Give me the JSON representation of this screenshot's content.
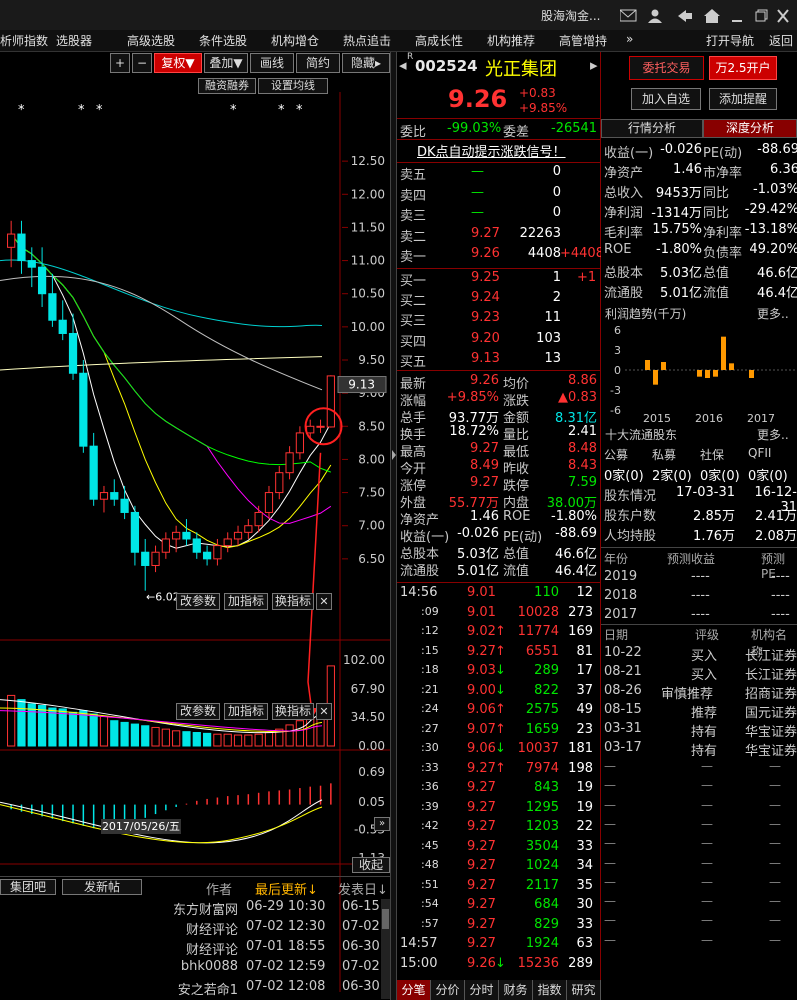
{
  "title": "股海淘金...",
  "menu": [
    "析师指数",
    "选股器",
    "高级选股",
    "条件选股",
    "机构增仓",
    "热点追击",
    "高成长性",
    "机构推荐",
    "高管增持",
    "»",
    "打开导航",
    "返回"
  ],
  "toolbar": {
    "plus": "+",
    "minus": "−",
    "fuquan": "复权▼",
    "diejia": "叠加▼",
    "huaxian": "画线",
    "jianyue": "简约",
    "yincang": "隐藏▸",
    "rongzi": "融资融券",
    "shezhi": "设置均线"
  },
  "stock": {
    "code": "002524",
    "name": "光正集团",
    "price": "9.26",
    "change": "+0.83",
    "change_pct": "+9.85%"
  },
  "buttons": {
    "weituo": "委托交易",
    "wan": "万2.5开户",
    "jiaru": "加入自选",
    "tixing": "添加提醒"
  },
  "weibi": {
    "label1": "委比",
    "value1": "-99.03%",
    "label2": "委差",
    "value2": "-26541"
  },
  "signal": "DK点自动提示涨跌信号！",
  "sell": [
    {
      "label": "卖五",
      "price": "—",
      "vol": "0",
      "chg": ""
    },
    {
      "label": "卖四",
      "price": "—",
      "vol": "0",
      "chg": ""
    },
    {
      "label": "卖三",
      "price": "—",
      "vol": "0",
      "chg": ""
    },
    {
      "label": "卖二",
      "price": "9.27",
      "vol": "22263",
      "chg": ""
    },
    {
      "label": "卖一",
      "price": "9.26",
      "vol": "4408",
      "chg": "+4408"
    }
  ],
  "buy": [
    {
      "label": "买一",
      "price": "9.25",
      "vol": "1",
      "chg": "+1"
    },
    {
      "label": "买二",
      "price": "9.24",
      "vol": "2",
      "chg": ""
    },
    {
      "label": "买三",
      "price": "9.23",
      "vol": "11",
      "chg": ""
    },
    {
      "label": "买四",
      "price": "9.20",
      "vol": "103",
      "chg": ""
    },
    {
      "label": "买五",
      "price": "9.13",
      "vol": "13",
      "chg": ""
    }
  ],
  "stats": [
    [
      "最新",
      "9.26",
      "均价",
      "8.86"
    ],
    [
      "涨幅",
      "+9.85%",
      "涨跌",
      "▲0.83"
    ],
    [
      "总手",
      "93.77万",
      "金额",
      "8.31亿"
    ],
    [
      "换手",
      "18.72%",
      "量比",
      "2.41"
    ],
    [
      "最高",
      "9.27",
      "最低",
      "8.48"
    ],
    [
      "今开",
      "8.49",
      "昨收",
      "8.43"
    ],
    [
      "涨停",
      "9.27",
      "跌停",
      "7.59"
    ],
    [
      "外盘",
      "55.77万",
      "内盘",
      "38.00万"
    ],
    [
      "净资产",
      "1.46",
      "ROE",
      "-1.80%"
    ],
    [
      "收益(一)",
      "-0.026",
      "PE(动)",
      "-88.69"
    ],
    [
      "总股本",
      "5.03亿",
      "总值",
      "46.6亿"
    ],
    [
      "流通股",
      "5.01亿",
      "流值",
      "46.4亿"
    ]
  ],
  "ticks": [
    {
      "t": "14:56",
      "p": "9.01",
      "a": "",
      "v": "110",
      "n": "12"
    },
    {
      "t": ":09",
      "p": "9.01",
      "a": "",
      "v": "10028",
      "n": "273"
    },
    {
      "t": ":12",
      "p": "9.02",
      "a": "↑",
      "v": "11774",
      "n": "169"
    },
    {
      "t": ":15",
      "p": "9.27",
      "a": "↑",
      "v": "6551",
      "n": "81"
    },
    {
      "t": ":18",
      "p": "9.03",
      "a": "↓",
      "v": "289",
      "n": "17"
    },
    {
      "t": ":21",
      "p": "9.00",
      "a": "↓",
      "v": "822",
      "n": "37"
    },
    {
      "t": ":24",
      "p": "9.06",
      "a": "↑",
      "v": "2575",
      "n": "49"
    },
    {
      "t": ":27",
      "p": "9.07",
      "a": "↑",
      "v": "1659",
      "n": "23"
    },
    {
      "t": ":30",
      "p": "9.06",
      "a": "↓",
      "v": "10037",
      "n": "181"
    },
    {
      "t": ":33",
      "p": "9.27",
      "a": "↑",
      "v": "7974",
      "n": "198"
    },
    {
      "t": ":36",
      "p": "9.27",
      "a": "",
      "v": "843",
      "n": "19"
    },
    {
      "t": ":39",
      "p": "9.27",
      "a": "",
      "v": "1295",
      "n": "19"
    },
    {
      "t": ":42",
      "p": "9.27",
      "a": "",
      "v": "1203",
      "n": "22"
    },
    {
      "t": ":45",
      "p": "9.27",
      "a": "",
      "v": "3504",
      "n": "33"
    },
    {
      "t": ":48",
      "p": "9.27",
      "a": "",
      "v": "1024",
      "n": "34"
    },
    {
      "t": ":51",
      "p": "9.27",
      "a": "",
      "v": "2117",
      "n": "35"
    },
    {
      "t": ":54",
      "p": "9.27",
      "a": "",
      "v": "684",
      "n": "30"
    },
    {
      "t": ":57",
      "p": "9.27",
      "a": "",
      "v": "829",
      "n": "33"
    },
    {
      "t": "14:57",
      "p": "9.27",
      "a": "",
      "v": "1924",
      "n": "63"
    },
    {
      "t": "15:00",
      "p": "9.26",
      "a": "↓",
      "v": "15236",
      "n": "289"
    }
  ],
  "mid_tabs": [
    "分笔",
    "分价",
    "分时",
    "财务",
    "指数",
    "研究"
  ],
  "right_tabs": [
    "行情分析",
    "深度分析"
  ],
  "fin": [
    [
      "收益(一)",
      "-0.026",
      "PE(动)",
      "-88.69"
    ],
    [
      "净资产",
      "1.46",
      "市净率",
      "6.36"
    ],
    [
      "总收入",
      "9453万",
      "同比",
      "-1.03%"
    ],
    [
      "净利润",
      "-1314万",
      "同比",
      "-29.42%"
    ],
    [
      "毛利率",
      "15.75%",
      "净利率",
      "-13.18%"
    ],
    [
      "ROE",
      "-1.80%",
      "负债率",
      "49.20%"
    ],
    [
      "总股本",
      "5.03亿",
      "总值",
      "46.6亿"
    ],
    [
      "流通股",
      "5.01亿",
      "流值",
      "46.4亿"
    ]
  ],
  "profit": {
    "title": "利润趋势(千万)",
    "more": "更多..",
    "years": [
      "2015",
      "2016",
      "2017"
    ],
    "yticks": [
      "6",
      "3",
      "0",
      "-3",
      "-6"
    ]
  },
  "holders": {
    "title": "十大流通股东",
    "more": "更多..",
    "heads": [
      "公募",
      "私募",
      "社保",
      "QFII"
    ],
    "counts": [
      "0家(0)",
      "2家(0)",
      "0家(0)",
      "0家(0)"
    ],
    "rows": [
      [
        "股东情况",
        "17-03-31",
        "16-12-31"
      ],
      [
        "股东户数",
        "2.85万",
        "2.41万"
      ],
      [
        "人均持股",
        "1.76万",
        "2.08万"
      ]
    ]
  },
  "forecast": {
    "heads": [
      "年份",
      "预测收益",
      "预测PE"
    ],
    "rows": [
      [
        "2019",
        "----",
        "----"
      ],
      [
        "2018",
        "----",
        "----"
      ],
      [
        "2017",
        "----",
        "----"
      ]
    ]
  },
  "ratings": {
    "heads": [
      "日期",
      "评级",
      "机构名称"
    ],
    "rows": [
      [
        "10-22",
        "买入",
        "长江证券"
      ],
      [
        "08-21",
        "买入",
        "长江证券"
      ],
      [
        "08-26",
        "审慎推荐",
        "招商证券"
      ],
      [
        "08-15",
        "推荐",
        "国元证券"
      ],
      [
        "03-31",
        "持有",
        "华宝证券"
      ],
      [
        "03-17",
        "持有",
        "华宝证券"
      ]
    ]
  },
  "chart_data": [
    {
      "type": "candlestick",
      "title": "",
      "yticks": [
        12.5,
        12.0,
        11.5,
        11.0,
        10.5,
        10.0,
        9.5,
        9.0,
        8.5,
        8.0,
        7.5,
        7.0,
        6.5
      ],
      "ylim": [
        6.0,
        13.0
      ],
      "current": "9.13",
      "low_label": "6.02",
      "date_label": "2017/05/26/五",
      "series": [
        {
          "name": "MA5",
          "color": "#ffffff"
        },
        {
          "name": "MA10",
          "color": "#ffff00"
        },
        {
          "name": "MA20",
          "color": "#ff00ff"
        },
        {
          "name": "MA30",
          "color": "#00ff00"
        },
        {
          "name": "MA60",
          "color": "#c0c0c0"
        },
        {
          "name": "MA120",
          "color": "#00d0d0"
        },
        {
          "name": "MA250",
          "color": "#ffffc0"
        }
      ],
      "candles": [
        [
          11.2,
          11.6,
          10.9,
          11.4
        ],
        [
          11.4,
          11.6,
          10.8,
          11.0
        ],
        [
          11.0,
          11.2,
          10.6,
          10.9
        ],
        [
          10.9,
          11.2,
          10.3,
          10.5
        ],
        [
          10.5,
          10.8,
          10.0,
          10.1
        ],
        [
          10.1,
          10.4,
          9.8,
          9.9
        ],
        [
          9.9,
          10.2,
          9.2,
          9.3
        ],
        [
          9.3,
          9.5,
          8.1,
          8.2
        ],
        [
          8.2,
          8.4,
          7.3,
          7.4
        ],
        [
          7.4,
          7.6,
          7.2,
          7.5
        ],
        [
          7.5,
          7.7,
          7.3,
          7.4
        ],
        [
          7.4,
          7.6,
          7.1,
          7.2
        ],
        [
          7.2,
          7.3,
          6.4,
          6.6
        ],
        [
          6.6,
          6.8,
          6.02,
          6.4
        ],
        [
          6.4,
          6.7,
          6.3,
          6.6
        ],
        [
          6.6,
          6.9,
          6.5,
          6.8
        ],
        [
          6.8,
          7.0,
          6.6,
          6.9
        ],
        [
          6.9,
          7.1,
          6.7,
          6.8
        ],
        [
          6.8,
          6.9,
          6.5,
          6.6
        ],
        [
          6.6,
          6.7,
          6.4,
          6.5
        ],
        [
          6.5,
          6.8,
          6.4,
          6.7
        ],
        [
          6.7,
          6.9,
          6.6,
          6.8
        ],
        [
          6.8,
          7.0,
          6.7,
          6.9
        ],
        [
          6.9,
          7.1,
          6.8,
          7.0
        ],
        [
          7.0,
          7.3,
          6.9,
          7.2
        ],
        [
          7.2,
          7.6,
          7.1,
          7.5
        ],
        [
          7.5,
          7.9,
          7.4,
          7.8
        ],
        [
          7.8,
          8.2,
          7.7,
          8.1
        ],
        [
          8.1,
          8.5,
          8.0,
          8.4
        ],
        [
          8.4,
          8.6,
          8.3,
          8.5
        ],
        [
          8.5,
          8.6,
          8.4,
          8.5
        ],
        [
          8.49,
          9.27,
          8.48,
          9.26
        ]
      ]
    },
    {
      "type": "bar",
      "title": "",
      "yticks": [
        "102.00",
        "67.90",
        "34.50",
        "0.00"
      ],
      "ylim": [
        0,
        102
      ],
      "values": [
        60,
        55,
        50,
        48,
        45,
        44,
        40,
        42,
        38,
        35,
        30,
        28,
        26,
        24,
        22,
        20,
        18,
        17,
        16,
        15,
        14,
        14,
        13,
        13,
        14,
        16,
        20,
        25,
        30,
        34,
        40,
        95
      ]
    },
    {
      "type": "bar",
      "title": "",
      "yticks": [
        "0.69",
        "0.05",
        "-0.53",
        "-1.13"
      ],
      "ylim": [
        -1.13,
        0.69
      ],
      "values": [
        -0.1,
        -0.15,
        -0.2,
        -0.25,
        -0.3,
        -0.35,
        -0.4,
        -0.45,
        -0.5,
        -0.52,
        -0.48,
        -0.42,
        -0.35,
        -0.28,
        -0.2,
        -0.12,
        -0.05,
        0.02,
        0.08,
        0.12,
        0.15,
        0.18,
        0.2,
        0.22,
        0.25,
        0.28,
        0.3,
        0.32,
        0.35,
        0.38,
        0.4,
        0.45
      ]
    }
  ],
  "sub_btns": [
    "改参数",
    "加指标",
    "换指标",
    "✕"
  ],
  "forum": {
    "left1": "集团吧",
    "left2": "发新帖",
    "h1": "作者",
    "h2": "最后更新↓",
    "h3": "发表日↓",
    "shouqi": "收起",
    "rows": [
      [
        "东方财富网",
        "06-29 10:30",
        "06-15"
      ],
      [
        "财经评论",
        "07-02 12:30",
        "07-02"
      ],
      [
        "财经评论",
        "07-01 18:55",
        "06-30"
      ],
      [
        "bhk0088",
        "07-02 12:59",
        "07-02"
      ],
      [
        "安之若命1",
        "07-02 12:08",
        "06-30"
      ]
    ]
  }
}
